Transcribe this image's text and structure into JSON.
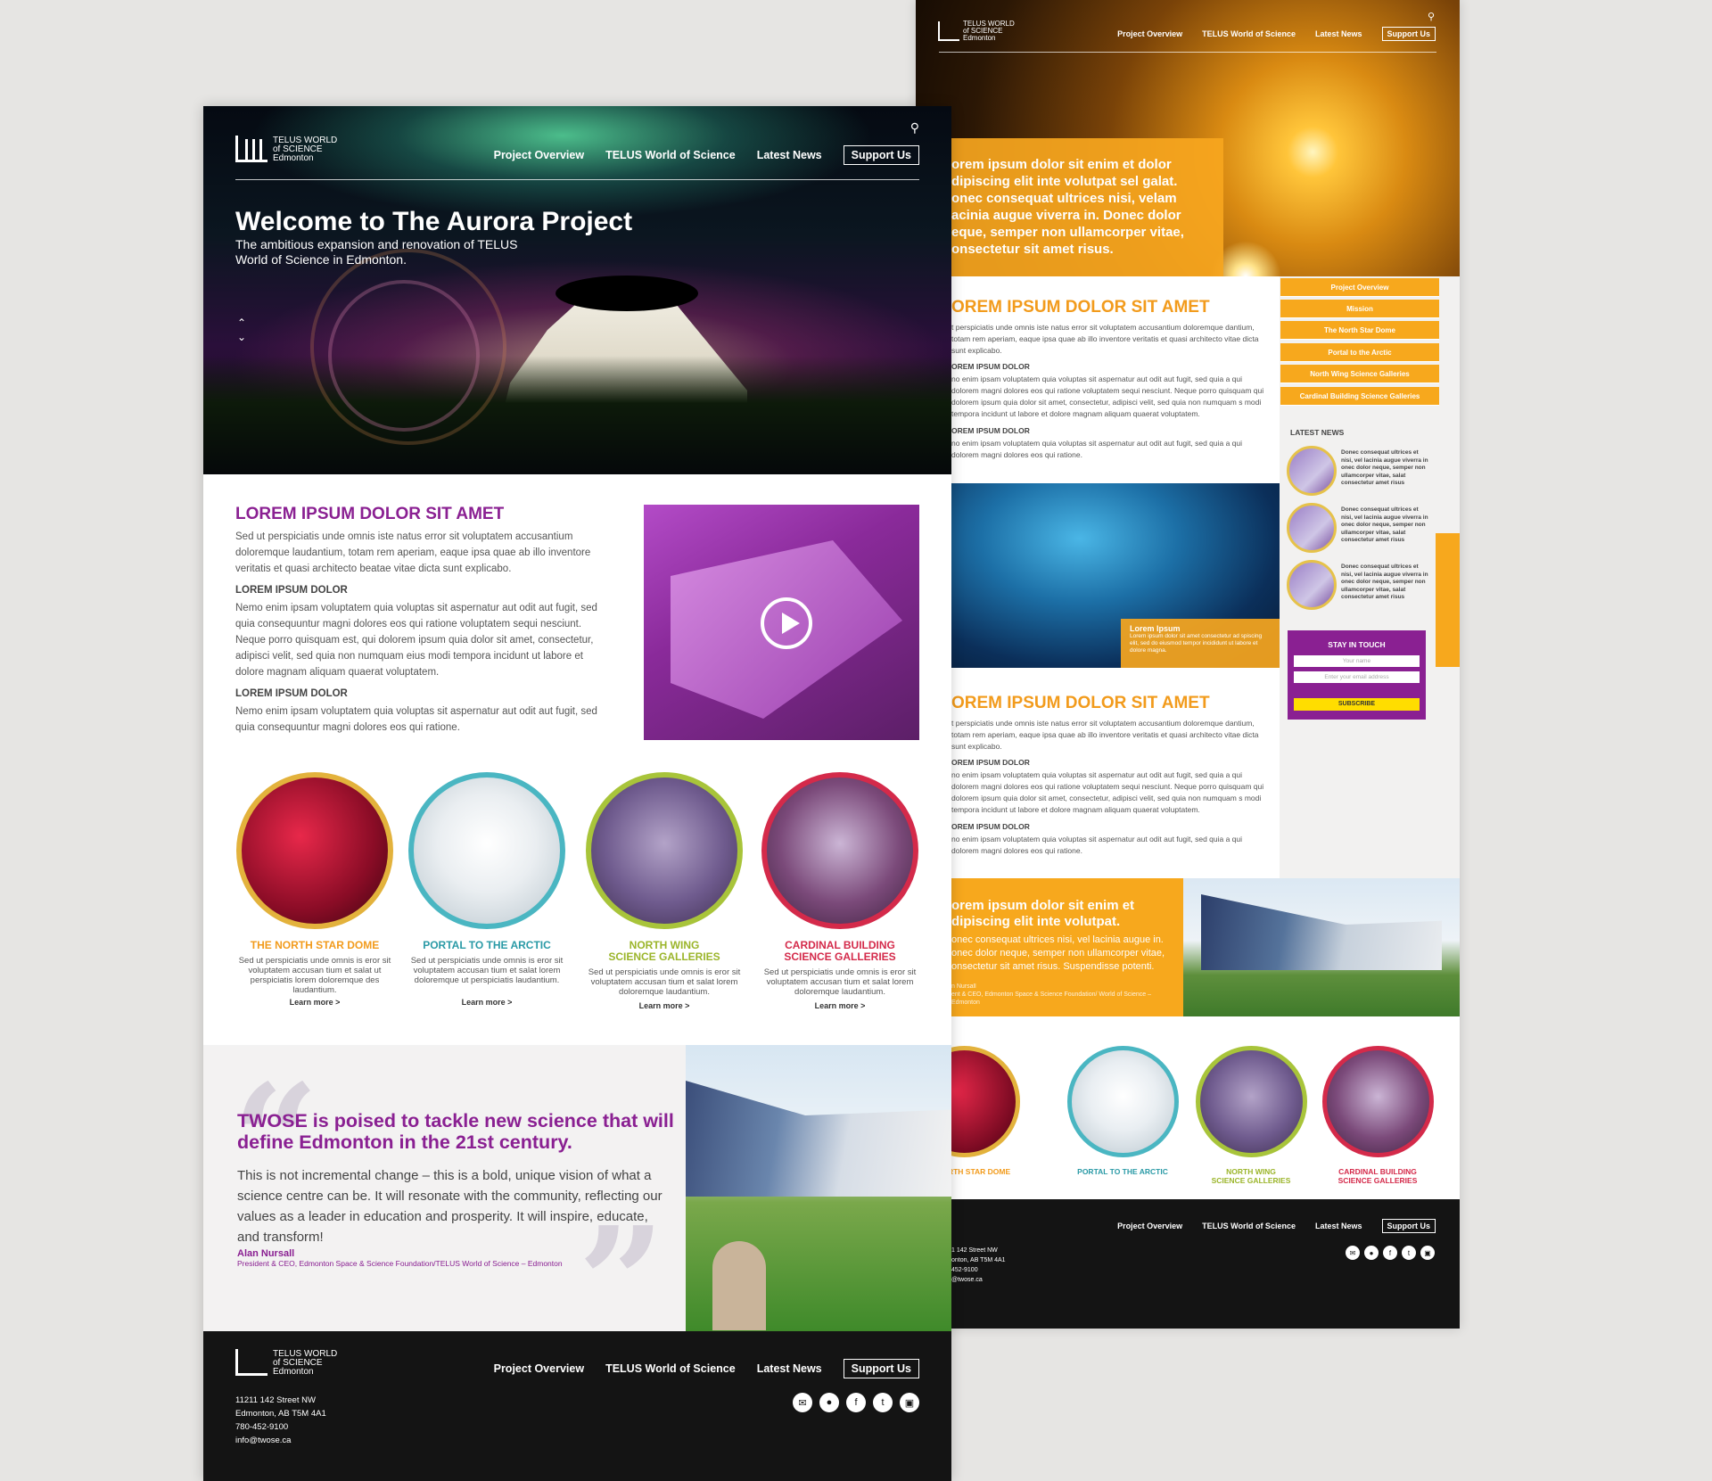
{
  "colors": {
    "purple": "#8a2092",
    "orange": "#f7a81d",
    "dark": "#141414",
    "aqua": "#4ab6c2",
    "green": "#a8c43a",
    "red": "#d42a4a"
  },
  "logo": {
    "line1": "TELUS WORLD",
    "line2": "of SCIENCE",
    "line3": "Edmonton"
  },
  "nav": {
    "overview": "Project Overview",
    "telus": "TELUS World of Science",
    "news": "Latest News",
    "support": "Support Us",
    "search_icon": "search-icon"
  },
  "front": {
    "hero": {
      "title": "Welcome to The Aurora Project",
      "subtitle": "The ambitious expansion and renovation of TELUS World of Science in Edmonton."
    },
    "section": {
      "heading": "LOREM IPSUM DOLOR SIT AMET",
      "p1": "Sed ut perspiciatis unde omnis iste natus error sit voluptatem accusantium doloremque laudantium, totam rem aperiam, eaque ipsa quae ab illo inventore veritatis et quasi architecto beatae vitae dicta sunt explicabo.",
      "sub1": "LOREM IPSUM DOLOR",
      "p2": "Nemo enim ipsam voluptatem quia voluptas sit aspernatur aut odit aut fugit, sed quia consequuntur magni dolores eos qui ratione voluptatem sequi nesciunt. Neque porro quisquam est, qui dolorem ipsum quia dolor sit amet, consectetur, adipisci velit, sed quia non numquam eius modi tempora incidunt ut labore et dolore magnam aliquam quaerat voluptatem.",
      "sub2": "LOREM IPSUM DOLOR",
      "p3": "Nemo enim ipsam voluptatem quia voluptas sit aspernatur aut odit aut fugit, sed quia consequuntur magni dolores eos qui ratione."
    },
    "galleries": [
      {
        "title1": "THE NORTH STAR DOME",
        "title2": "",
        "desc": "Sed ut perspiciatis unde omnis is eror sit voluptatem accusan tium et salat ut perspiciatis lorem doloremque des laudantium.",
        "more": "Learn more >"
      },
      {
        "title1": "PORTAL TO THE ARCTIC",
        "title2": "",
        "desc": "Sed ut perspiciatis unde omnis is eror sit voluptatem accusan tium et salat lorem doloremque ut perspiciatis laudantium.",
        "more": "Learn more >"
      },
      {
        "title1": "NORTH WING",
        "title2": "SCIENCE GALLERIES",
        "desc": "Sed ut perspiciatis unde omnis is eror sit voluptatem accusan tium et salat lorem doloremque laudantium.",
        "more": "Learn more >"
      },
      {
        "title1": "CARDINAL BUILDING",
        "title2": "SCIENCE GALLERIES",
        "desc": "Sed ut perspiciatis unde omnis is eror sit voluptatem accusan tium et salat lorem doloremque laudantium.",
        "more": "Learn more >"
      }
    ],
    "quote": {
      "heading": "TWOSE is poised to tackle new science that will define Edmonton in the 21st century.",
      "body": "This is not incremental change – this is a bold, unique vision of what a science centre can be. It will resonate with the community, reflecting our values as a leader in education and prosperity. It will inspire, educate, and transform!",
      "author": "Alan Nursall",
      "role": "President & CEO, Edmonton Space & Science Foundation/TELUS World of Science – Edmonton"
    },
    "footer": {
      "addr1": "11211 142 Street NW",
      "addr2": "Edmonton, AB T5M 4A1",
      "phone": "780-452-9100",
      "email": "info@twose.ca"
    }
  },
  "back": {
    "hero_text": "orem ipsum dolor sit enim et dolor dipiscing elit inte volutpat sel galat. onec consequat ultrices nisi, velam acinia augue viverra in. Donec dolor eque, semper non ullamcorper vitae, onsectetur sit amet risus.",
    "heading": "OREM IPSUM DOLOR SIT AMET",
    "p1": "t perspiciatis unde omnis iste natus error sit voluptatem accusantium doloremque dantium, totam rem aperiam, eaque ipsa quae ab illo inventore veritatis et quasi architecto vitae dicta sunt explicabo.",
    "sub1": "OREM IPSUM DOLOR",
    "p2": "no enim ipsam voluptatem quia voluptas sit aspernatur aut odit aut fugit, sed quia a qui dolorem magni dolores eos qui ratione voluptatem sequi nesciunt. Neque porro quisquam qui dolorem ipsum quia dolor sit amet, consectetur, adipisci velit, sed quia non numquam s modi tempora incidunt ut labore et dolore magnam aliquam quaerat voluptatem.",
    "sub2": "OREM IPSUM DOLOR",
    "p3": "no enim ipsam voluptatem quia voluptas sit aspernatur aut odit aut fugit, sed quia a qui dolorem magni dolores eos qui ratione.",
    "sidebar": [
      "Project Overview",
      "Mission",
      "The North Star Dome",
      "Portal to the Arctic",
      "North Wing Science Galleries",
      "Cardinal Building Science Galleries"
    ],
    "latest_title": "LATEST NEWS",
    "news_text": "Donec consequat ultrices et nisi, vel lacinia augue viverra in onec dolor neque, semper non ullamcorper vitae, salat consectetur amet risus",
    "stay": {
      "title": "STAY IN TOUCH",
      "name_ph": "Your name",
      "email_ph": "Enter your email address",
      "button": "SUBSCRIBE"
    },
    "dome_caption": {
      "title": "Lorem Ipsum",
      "text": "Lorem ipsum dolor sit amet consectetur ad spiscing elit, sed do eiusmod tempor incididunt ut labore et dolore magna."
    },
    "quote": {
      "q": "orem ipsum dolor sit enim et dipiscing elit inte volutpat.",
      "q2": "onec consequat ultrices nisi, vel lacinia augue in. onec dolor neque, semper non ullamcorper vitae, onsectetur sit amet risus. Suspendisse potenti.",
      "author": "n Nursall",
      "role": "ent & CEO, Edmonton Space & Science Foundation/ World of Science – Edmonton"
    },
    "galleries": [
      {
        "t1": "THE NORTH STAR DOME",
        "t2": ""
      },
      {
        "t1": "PORTAL TO THE ARCTIC",
        "t2": ""
      },
      {
        "t1": "NORTH WING",
        "t2": "SCIENCE GALLERIES"
      },
      {
        "t1": "CARDINAL BUILDING",
        "t2": "SCIENCE GALLERIES"
      }
    ],
    "footer": {
      "addr1": "1 142 Street NW",
      "addr2": "onton, AB T5M 4A1",
      "phone": "452-9100",
      "email": "@twose.ca"
    }
  }
}
